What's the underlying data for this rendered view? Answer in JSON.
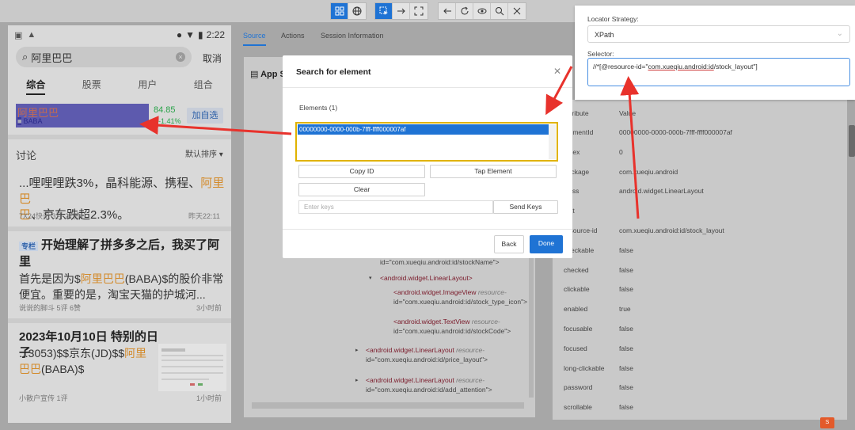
{
  "toolbar": {
    "icons": [
      "grid-icon",
      "globe-icon",
      "select-icon",
      "swipe-icon",
      "tap-icon",
      "back-icon",
      "refresh-icon",
      "eye-icon",
      "search-icon",
      "close-icon"
    ]
  },
  "phone": {
    "time": "2:22",
    "search_value": "阿里巴巴",
    "cancel": "取消",
    "tabs": [
      "综合",
      "股票",
      "用户",
      "组合"
    ],
    "stock": {
      "name": "阿里巴巴",
      "code": "BABA",
      "price": "84.85",
      "change": "-1.41%",
      "add_label": "加自选"
    },
    "discussion_title": "讨论",
    "sort_label": "默认排序",
    "posts": [
      {
        "text_a": "...哩哩哩跌3%，晶科能源、携程、",
        "hl_a": "阿里巴",
        "text_b": "巴",
        "text_c": "、京东跌超2.3%。",
        "meta_left": "7X24快讯  3评  27赞",
        "meta_right": "昨天22:11"
      },
      {
        "tag": "专栏",
        "title": "开始理解了拼多多之后，我买了阿里",
        "body_a": "首先是因为$",
        "hl": "阿里巴巴",
        "body_b": "(BABA)$的股价非常便宜。重要的是，淘宝天猫的护城河...",
        "meta_left": "说说的脚斗  5评  6赞",
        "meta_right": "3小时前"
      },
      {
        "title": "2023年10月10日 特别的日子",
        "body_a": "...3053)$$京东(JD)$$",
        "hl": "阿里巴巴",
        "body_b": "(BABA)$",
        "meta_left": "小散户宣传  1评",
        "meta_right": "1小时前"
      }
    ]
  },
  "inspector": {
    "tabs": [
      "Source",
      "Actions",
      "Session Information"
    ],
    "source_title": "App Source",
    "tree": [
      {
        "indent": 0,
        "caret": "",
        "line1_attr_val": "id=\"com.xueqiu.android:id/stockName\">"
      },
      {
        "indent": 1,
        "caret": "▾",
        "tag": "<android.widget.LinearLayout>"
      },
      {
        "indent": 2,
        "caret": "",
        "tag": "<android.widget.ImageView",
        "attr": "resource-",
        "val": "id=\"com.xueqiu.android:id/stock_type_icon\">"
      },
      {
        "indent": 2,
        "caret": "",
        "tag": "<android.widget.TextView",
        "attr": "resource-",
        "val": "id=\"com.xueqiu.android:id/stockCode\">"
      },
      {
        "indent": 0,
        "caret": "▸",
        "tag": "<android.widget.LinearLayout",
        "attr": "resource-",
        "val": "id=\"com.xueqiu.android:id/price_layout\">"
      },
      {
        "indent": 0,
        "caret": "▸",
        "tag": "<android.widget.LinearLayout",
        "attr": "resource-",
        "val": "id=\"com.xueqiu.android:id/add_attention\">"
      }
    ]
  },
  "attributes": {
    "header_key": "Attribute",
    "header_value": "Value",
    "rows": [
      {
        "k": "elementId",
        "v": "00000000-0000-000b-7fff-ffff000007af"
      },
      {
        "k": "index",
        "v": "0"
      },
      {
        "k": "package",
        "v": "com.xueqiu.android"
      },
      {
        "k": "class",
        "v": "android.widget.LinearLayout"
      },
      {
        "k": "text",
        "v": ""
      },
      {
        "k": "resource-id",
        "v": "com.xueqiu.android:id/stock_layout"
      },
      {
        "k": "checkable",
        "v": "false"
      },
      {
        "k": "checked",
        "v": "false"
      },
      {
        "k": "clickable",
        "v": "false"
      },
      {
        "k": "enabled",
        "v": "true"
      },
      {
        "k": "focusable",
        "v": "false"
      },
      {
        "k": "focused",
        "v": "false"
      },
      {
        "k": "long-clickable",
        "v": "false"
      },
      {
        "k": "password",
        "v": "false"
      },
      {
        "k": "scrollable",
        "v": "false"
      }
    ]
  },
  "locator": {
    "strategy_label": "Locator Strategy:",
    "strategy_value": "XPath",
    "selector_label": "Selector:",
    "selector_prefix": "//*[@resource-id=\"",
    "selector_underlined": "com.xueqiu.android:id",
    "selector_suffix": "/stock_layout\"]"
  },
  "modal": {
    "title": "Search for element",
    "elements_label": "Elements (1)",
    "element_id": "00000000-0000-000b-7fff-ffff000007af",
    "copy_id": "Copy ID",
    "tap_element": "Tap Element",
    "clear": "Clear",
    "keys_placeholder": "Enter keys",
    "send_keys": "Send Keys",
    "back": "Back",
    "done": "Done"
  },
  "colors": {
    "accent": "#1f73d4",
    "highlight_border": "#e0b300",
    "annotation_arrow": "#e8322c"
  }
}
